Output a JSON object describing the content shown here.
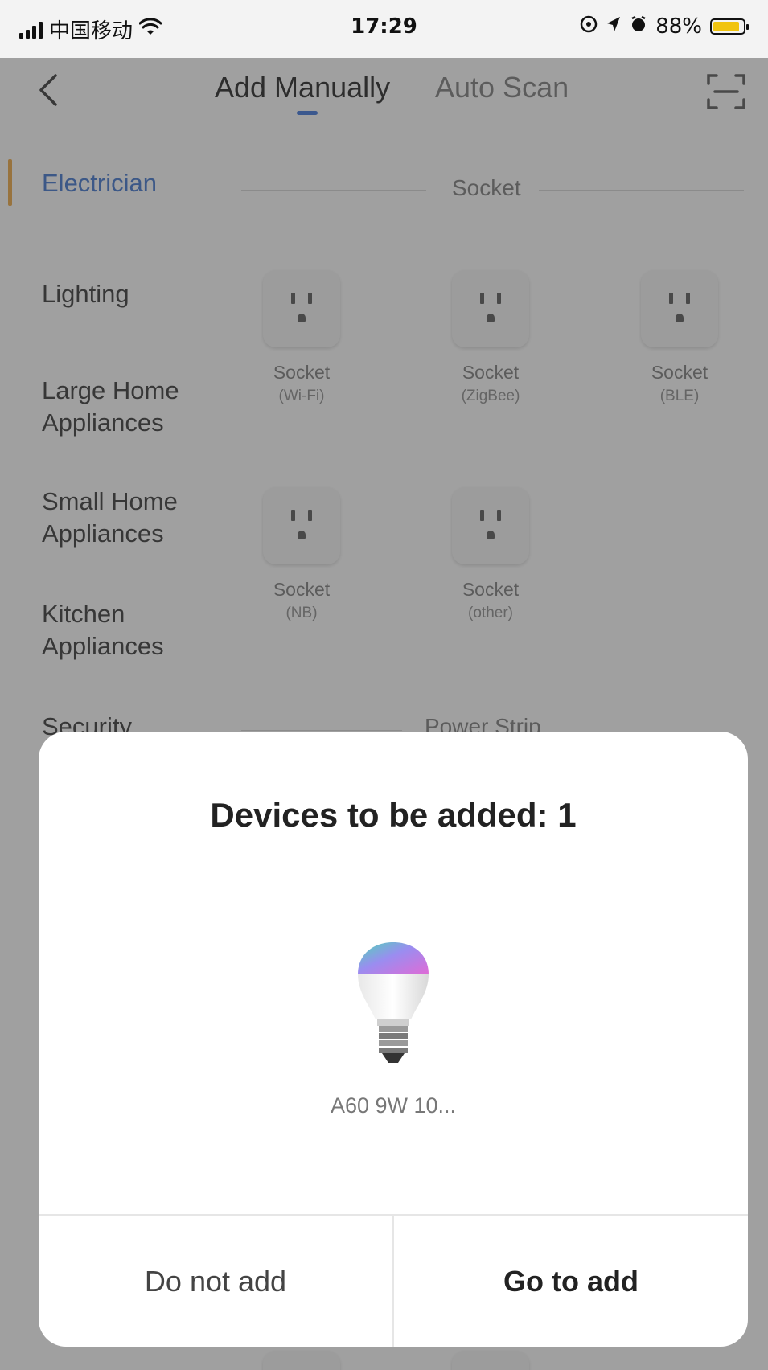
{
  "status_bar": {
    "carrier": "中国移动",
    "time": "17:29",
    "battery": "88%",
    "battery_level": 0.88,
    "icons": [
      "signal-icon",
      "wifi-icon",
      "location-lock-icon",
      "location-arrow-icon",
      "alarm-icon",
      "battery-icon"
    ]
  },
  "nav": {
    "back_icon": "‹",
    "tabs": [
      {
        "label": "Add Manually",
        "active": true
      },
      {
        "label": "Auto Scan",
        "active": false
      }
    ],
    "scan_icon": "scan-icon"
  },
  "sidebar": {
    "items": [
      {
        "label": "Electrician",
        "active": true
      },
      {
        "label": "Lighting"
      },
      {
        "label": "Large Home Appliances"
      },
      {
        "label": "Small Home Appliances"
      },
      {
        "label": "Kitchen Appliances"
      },
      {
        "label": "Security"
      }
    ]
  },
  "content": {
    "section_socket": "Socket",
    "section_power_strip": "Power Strip",
    "devices": [
      {
        "name": "Socket",
        "sub": "(Wi-Fi)"
      },
      {
        "name": "Socket",
        "sub": "(ZigBee)"
      },
      {
        "name": "Socket",
        "sub": "(BLE)"
      },
      {
        "name": "Socket",
        "sub": "(NB)"
      },
      {
        "name": "Socket",
        "sub": "(other)"
      }
    ]
  },
  "modal": {
    "title": "Devices to be added: 1",
    "device_label": "A60 9W 10...",
    "cancel_label": "Do not add",
    "confirm_label": "Go to add"
  },
  "colors": {
    "accent": "#3b6fd1",
    "active_category": "#3d6fc5",
    "active_marker": "#e4a040",
    "battery": "#f1c40f"
  }
}
